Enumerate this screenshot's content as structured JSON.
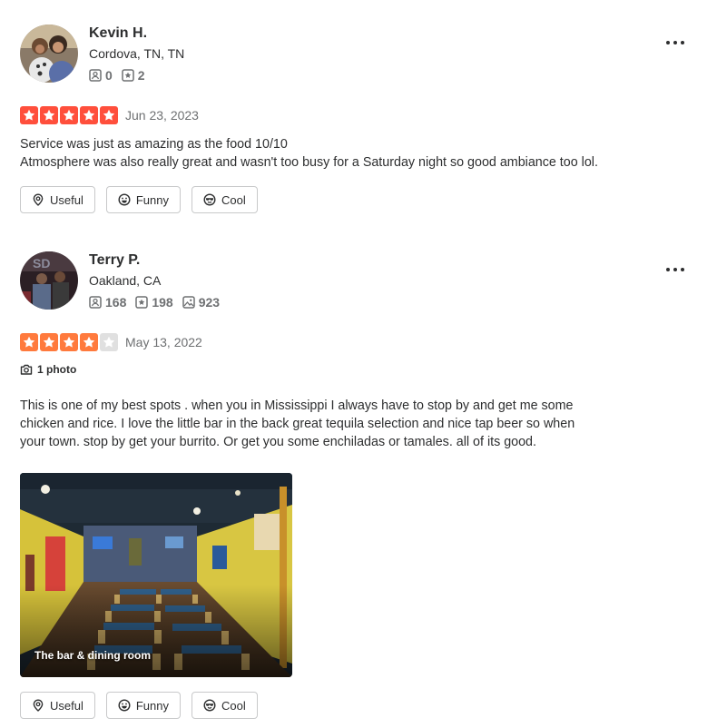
{
  "colors": {
    "star_five": "#ff4f3c",
    "star_four": "#ff7a3d",
    "star_empty": "#e0e0e0",
    "text_primary": "#2d2e2f",
    "text_secondary": "#6e7072",
    "border": "#c8c9ca"
  },
  "reviews": [
    {
      "user": {
        "name": "Kevin H.",
        "location": "Cordova, TN, TN",
        "friends": "0",
        "reviews": "2"
      },
      "rating": 5,
      "date": "Jun 23, 2023",
      "text": "Service was just as amazing as the food 10/10\nAtmosphere was also really great and wasn't too busy for a Saturday night so good ambiance too lol.",
      "actions": {
        "useful": "Useful",
        "funny": "Funny",
        "cool": "Cool"
      }
    },
    {
      "user": {
        "name": "Terry P.",
        "location": "Oakland, CA",
        "friends": "168",
        "reviews": "198",
        "photos": "923"
      },
      "rating": 4,
      "date": "May 13, 2022",
      "photo_count": "1 photo",
      "text": "This is one of my best spots . when you in Mississippi I always have to stop by and get me some chicken and rice. I love the little bar in the back great tequila selection and nice tap beer so when your town. stop by get your burrito. Or get you some enchiladas or tamales. all of its good.",
      "photo_caption": "The bar & dining room",
      "actions": {
        "useful": "Useful",
        "funny": "Funny",
        "cool": "Cool"
      }
    }
  ]
}
